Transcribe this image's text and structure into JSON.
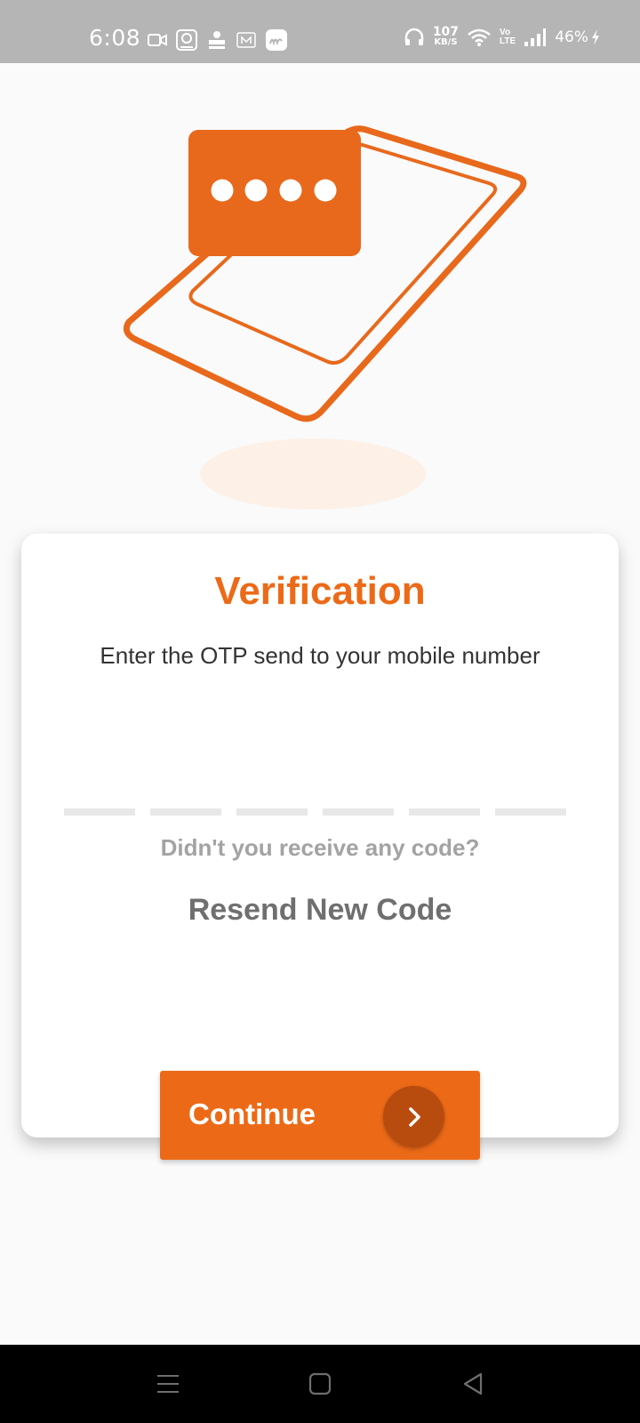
{
  "status_bar": {
    "time": "6:08",
    "net_speed_value": "107",
    "net_speed_unit": "KB/S",
    "volte_top": "Vo",
    "volte_bottom": "LTE",
    "battery": "46%",
    "icons": [
      "video-call-icon",
      "app-icon",
      "app-icon-2",
      "m-icon",
      "my-app-icon",
      "headphones-icon",
      "wifi-icon",
      "signal-icon",
      "charging-icon"
    ]
  },
  "verification": {
    "title": "Verification",
    "subtitle": "Enter the OTP send to your mobile number",
    "otp_cells": [
      "",
      "",
      "",
      "",
      "",
      ""
    ],
    "question": "Didn't you receive any code?",
    "resend": "Resend New Code"
  },
  "continue_button": {
    "label": "Continue"
  },
  "colors": {
    "accent": "#ec6a17",
    "accent_dark": "#b84c0f",
    "title": "#ec6a17",
    "muted": "#a3a3a3"
  },
  "nav_bar": {
    "items": [
      "menu-icon",
      "home-icon",
      "back-icon"
    ]
  }
}
